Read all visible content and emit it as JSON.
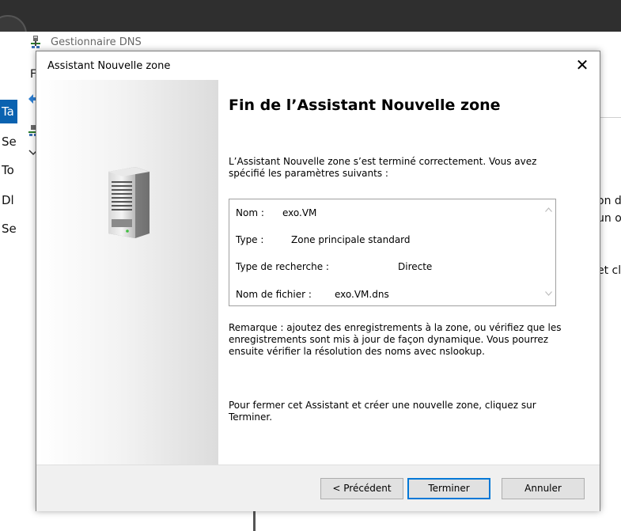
{
  "background_window": {
    "app_title": "Gestionnaire DNS",
    "menu_letter": "F",
    "left_items": [
      "Ta",
      "Se",
      "To",
      "Dl",
      "Se"
    ],
    "right_snippets": [
      "on d",
      "un ou",
      "et cli"
    ]
  },
  "dialog": {
    "title": "Assistant Nouvelle zone",
    "close_glyph": "✕",
    "heading": "Fin de l’Assistant Nouvelle zone",
    "intro": "L’Assistant Nouvelle zone s’est terminé correctement. Vous avez spécifié les paramètres suivants :",
    "summary": [
      {
        "label": "Nom :",
        "value": "exo.VM"
      },
      {
        "label": "Type :",
        "value": "Zone principale standard"
      },
      {
        "label": "Type de recherche :",
        "value": "Directe"
      },
      {
        "label": "Nom de fichier :",
        "value": "exo.VM.dns"
      }
    ],
    "note": "Remarque : ajoutez des enregistrements à la zone, ou vérifiez que les enregistrements sont mis à jour de façon dynamique. Vous pourrez ensuite vérifier la résolution des noms avec nslookup.",
    "close_hint": "Pour fermer cet Assistant et créer une nouvelle zone, cliquez sur Terminer.",
    "buttons": {
      "previous": "< Précédent",
      "finish": "Terminer",
      "cancel": "Annuler"
    }
  },
  "colors": {
    "accent": "#0078d7",
    "topbar": "#2f2f2f",
    "tab_blue": "#0a62b0",
    "footer": "#f0f0f0"
  },
  "icons": [
    "server-icon",
    "close-icon",
    "scroll-up-icon",
    "scroll-down-icon",
    "dns-app-icon",
    "back-arrow-icon",
    "tree-node-icon",
    "chevron-down-icon"
  ]
}
